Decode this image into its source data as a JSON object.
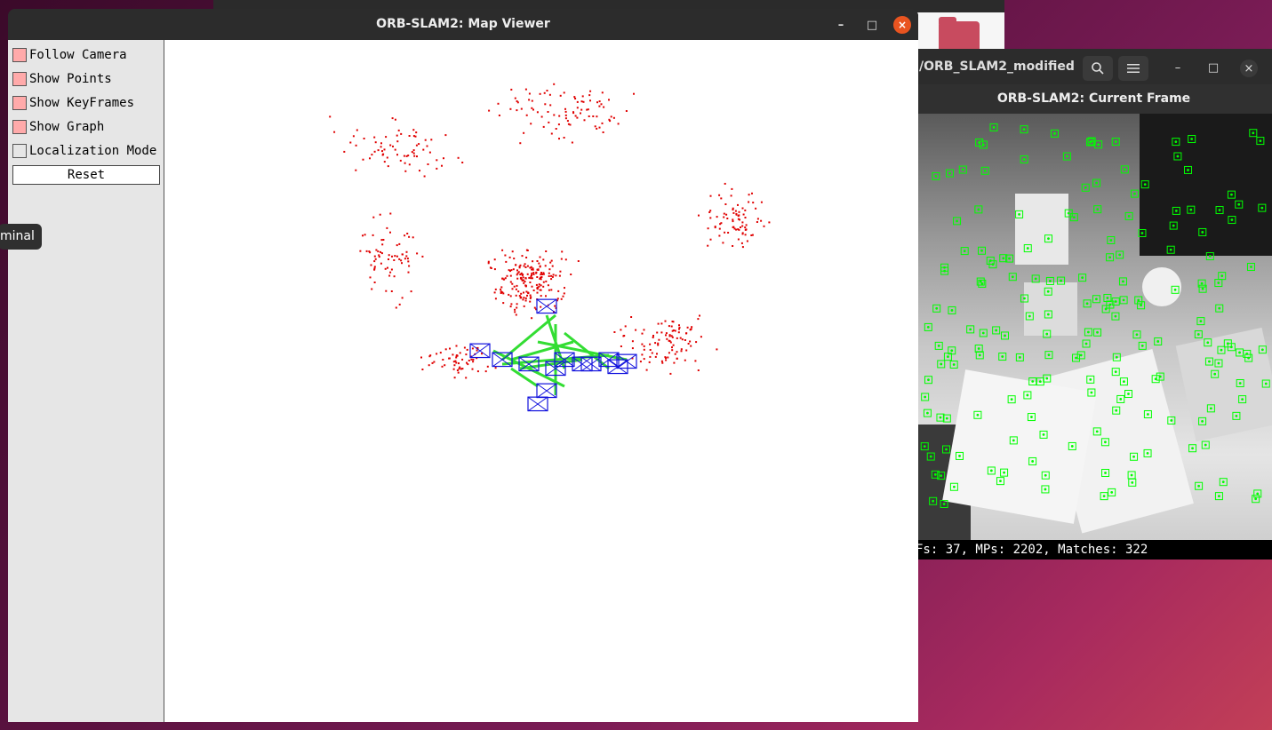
{
  "map_viewer": {
    "title": "ORB-SLAM2: Map Viewer",
    "panel": {
      "follow_camera": "Follow Camera",
      "show_points": "Show Points",
      "show_keyframes": "Show KeyFrames",
      "show_graph": "Show Graph",
      "localization_mode": "Localization Mode",
      "reset": "Reset"
    },
    "controls": {
      "minimize": "–",
      "maximize": "□",
      "close": "×"
    }
  },
  "frame_window": {
    "path": "/ORB_SLAM2_modified",
    "title": "ORB-SLAM2: Current Frame",
    "status": "Fs: 37, MPs: 2202, Matches: 322",
    "controls": {
      "minimize": "–",
      "maximize": "□",
      "close": "×"
    }
  },
  "tooltip": "minal",
  "colors": {
    "map_points": "#e00000",
    "keyframes": "#1010dd",
    "graph": "#33dd33",
    "features": "#00ff00",
    "accent": "#e95420"
  },
  "icons": [
    "search-icon",
    "hamburger-menu-icon",
    "minimize-icon",
    "maximize-icon",
    "close-icon",
    "folder-icon"
  ]
}
